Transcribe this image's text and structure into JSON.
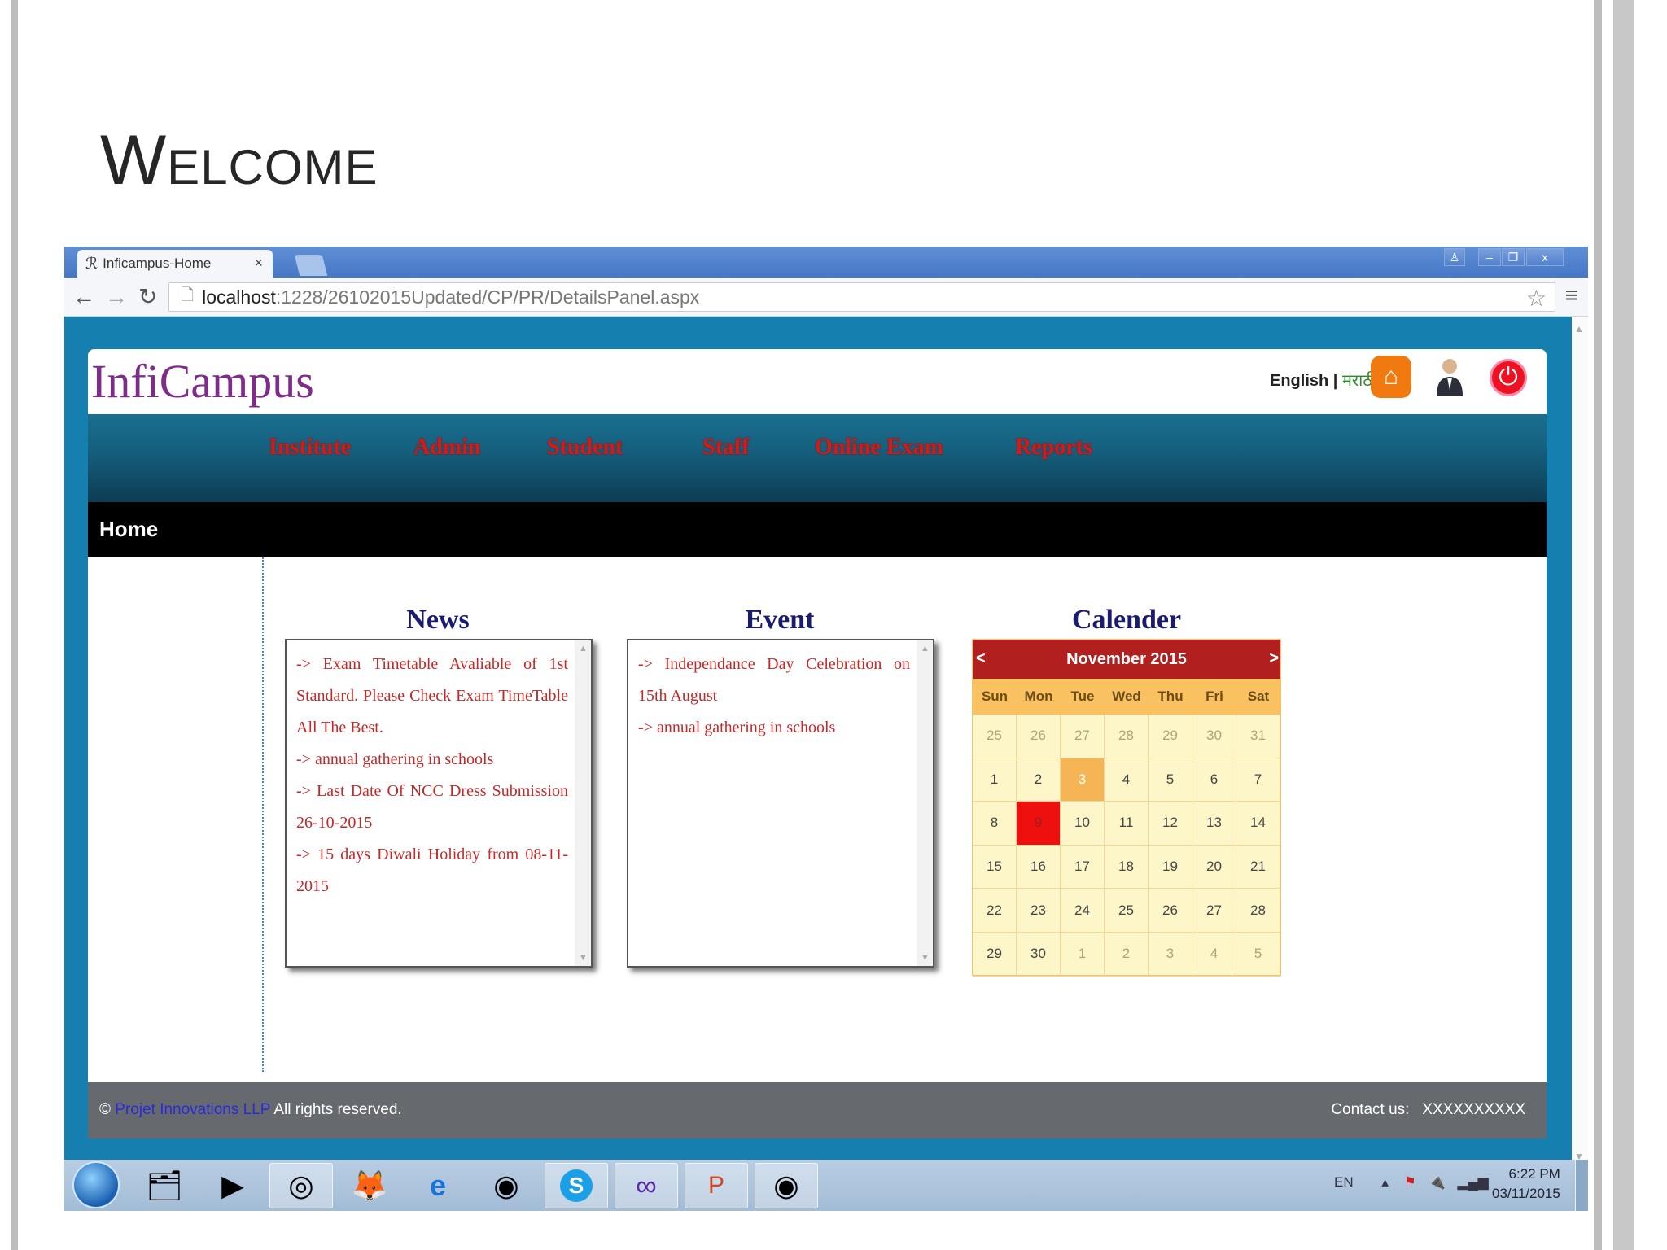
{
  "slide": {
    "title": "Welcome"
  },
  "browser": {
    "tab_title": "Inficampus-Home",
    "tab_close": "×",
    "url_host": "localhost",
    "url_path": ":1228/26102015Updated/CP/PR/DetailsPanel.aspx"
  },
  "app": {
    "logo": "InfiCampus",
    "lang_english": "English",
    "lang_sep": "|",
    "lang_marathi": "मराठी",
    "nav": [
      "Institute",
      "Admin",
      "Student",
      "Staff",
      "Online Exam",
      "Reports"
    ],
    "breadcrumb": "Home"
  },
  "news": {
    "title": "News",
    "items": [
      "-> Exam Timetable Avaliable of 1st Standard. Please Check Exam TimeTable All The Best.",
      "-> annual gathering in schools",
      "-> Last Date Of NCC Dress Submission 26-10-2015",
      "-> 15 days Diwali Holiday from 08-11-2015"
    ]
  },
  "event": {
    "title": "Event",
    "items": [
      "-> Independance Day Celebration on 15th August",
      "-> annual gathering in schools"
    ]
  },
  "calendar": {
    "title": "Calender",
    "month": "November 2015",
    "prev": "<",
    "next": ">",
    "days": [
      "Sun",
      "Mon",
      "Tue",
      "Wed",
      "Thu",
      "Fri",
      "Sat"
    ],
    "cells": [
      "25",
      "26",
      "27",
      "28",
      "29",
      "30",
      "31",
      "1",
      "2",
      "3",
      "4",
      "5",
      "6",
      "7",
      "8",
      "9",
      "10",
      "11",
      "12",
      "13",
      "14",
      "15",
      "16",
      "17",
      "18",
      "19",
      "20",
      "21",
      "22",
      "23",
      "24",
      "25",
      "26",
      "27",
      "28",
      "29",
      "30",
      "1",
      "2",
      "3",
      "4",
      "5"
    ],
    "today": "3",
    "selected": "9"
  },
  "footer": {
    "copyright_symbol": "©",
    "company": "Projet Innovations LLP",
    "rights": "All rights reserved.",
    "contact_label": "Contact us:",
    "contact_value": "XXXXXXXXXX"
  },
  "taskbar": {
    "lang": "EN",
    "time": "6:22 PM",
    "date": "03/11/2015"
  },
  "colors": {
    "nav_text": "#d21a1a",
    "brand": "#7d2c8a",
    "calendar_header": "#b21f1f",
    "frame": "#1580b0"
  }
}
